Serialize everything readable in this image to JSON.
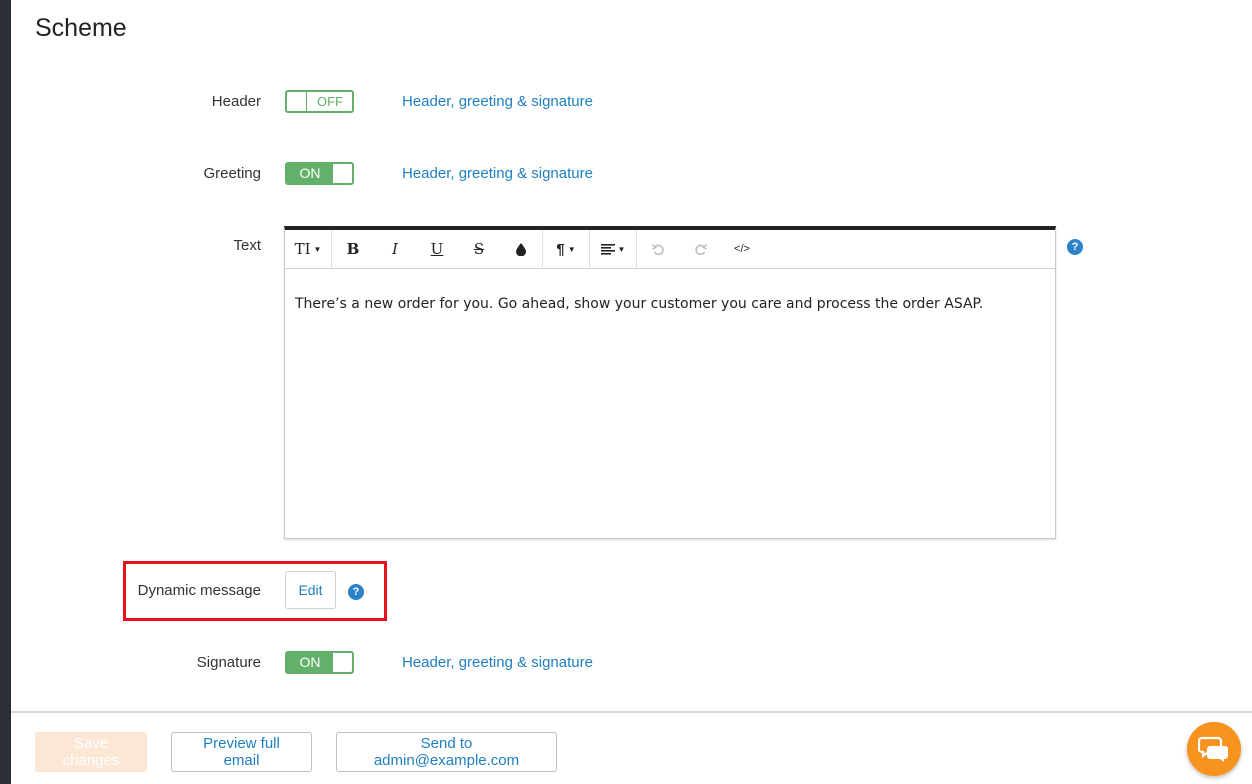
{
  "page": {
    "title": "Scheme"
  },
  "rows": {
    "header": {
      "label": "Header",
      "toggle": "OFF",
      "link": "Header, greeting & signature"
    },
    "greeting": {
      "label": "Greeting",
      "toggle": "ON",
      "link": "Header, greeting & signature"
    },
    "text": {
      "label": "Text"
    },
    "dynamic": {
      "label": "Dynamic message",
      "edit_label": "Edit"
    },
    "signature": {
      "label": "Signature",
      "toggle": "ON",
      "link": "Header, greeting & signature"
    }
  },
  "editor": {
    "toolbar": {
      "font_size": "TI",
      "bold": "B",
      "italic": "I",
      "underline": "U",
      "strike": "S",
      "paragraph": "¶",
      "code": "</>"
    },
    "content": "There’s a new order for you. Go ahead, show your customer you care and process the order ASAP."
  },
  "help": {
    "glyph": "?"
  },
  "footer": {
    "save_label": "Save changes",
    "preview_label": "Preview full email",
    "send_label": "Send to admin@example.com"
  },
  "colors": {
    "toggle_green": "#62b069",
    "link_blue": "#1f7fc0",
    "highlight_red": "#e8101a",
    "chat_orange": "#f7931e"
  }
}
